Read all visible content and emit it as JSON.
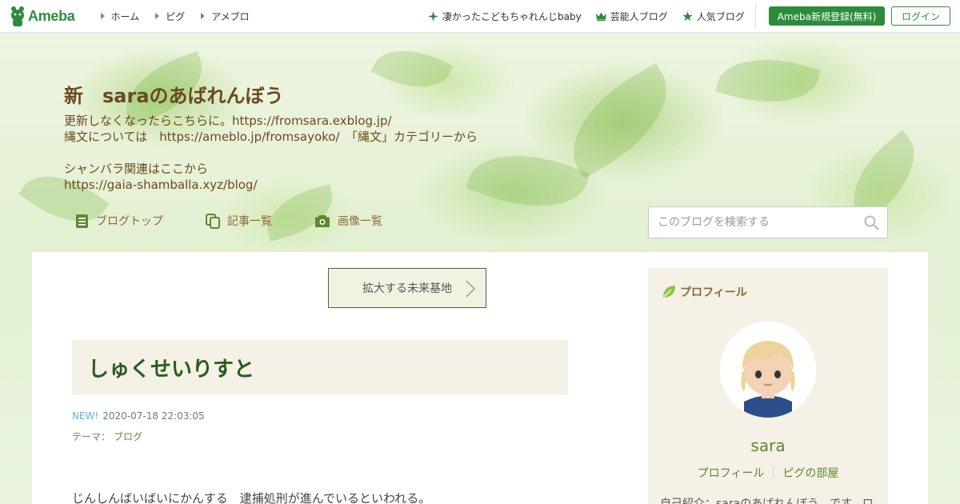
{
  "globalnav": {
    "logo_text": "Ameba",
    "left_links": [
      "ホーム",
      "ピグ",
      "アメブロ"
    ],
    "right_links": [
      {
        "icon": "sparkle-icon",
        "label": "凄かったこどもちゃれんじbaby"
      },
      {
        "icon": "crown-icon",
        "label": "芸能人ブログ"
      },
      {
        "icon": "star-icon",
        "label": "人気ブログ"
      }
    ],
    "register_label": "Ameba新規登録(無料)",
    "login_label": "ログイン"
  },
  "header": {
    "title": "新　saraのあばれんぼう",
    "description_lines": [
      "更新しなくなったらこちらに。https://fromsara.exblog.jp/",
      "縄文については　https://ameblo.jp/fromsayoko/　「縄文」カテゴリーから",
      "",
      "シャンバラ関連はここから",
      "https://gaia-shamballa.xyz/blog/"
    ],
    "nav": [
      {
        "icon": "document-icon",
        "label": "ブログトップ"
      },
      {
        "icon": "copy-icon",
        "label": "記事一覧"
      },
      {
        "icon": "camera-icon",
        "label": "画像一覧"
      }
    ],
    "search_placeholder": "このブログを検索する"
  },
  "main": {
    "theme_button": "拡大する未来基地",
    "entry_title": "しゅくせいりすと",
    "new_label": "NEW!",
    "date": "2020-07-18 22:03:05",
    "theme_prefix": "テーマ：",
    "theme_name": "ブログ",
    "body_first_line": "じんしんばいばいにかんする　逮捕処刑が進んでいるといわれる。"
  },
  "sidebar": {
    "profile_heading": "プロフィール",
    "name": "sara",
    "links": [
      "プロフィール",
      "ピグの部屋"
    ],
    "intro": "自己紹介：saraのあばれんぼう　です。ロ"
  },
  "colors": {
    "brand_green": "#2d8c3c",
    "title_brown": "#6b4a1f",
    "link_green": "#5c8a2e",
    "panel_beige": "#f5f1e6"
  }
}
